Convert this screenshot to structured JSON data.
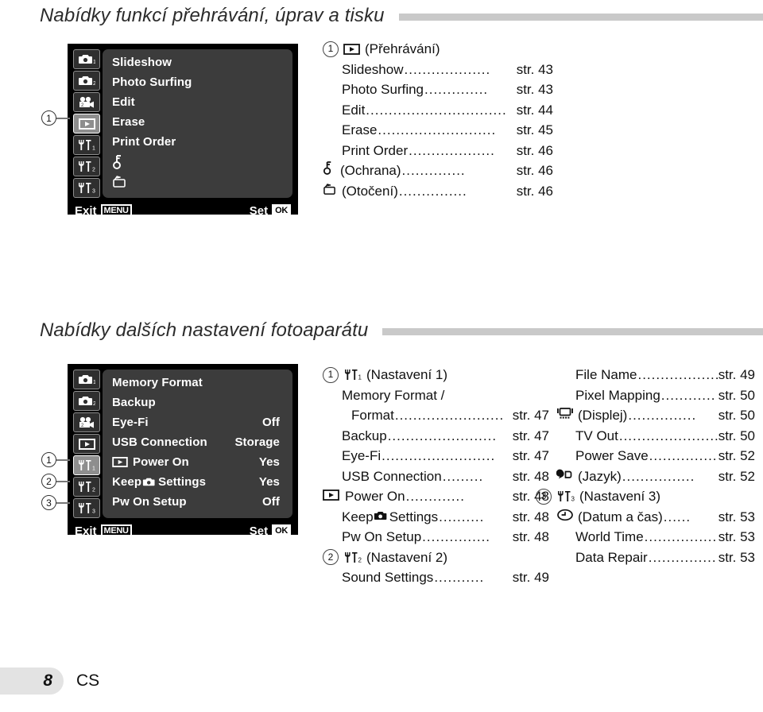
{
  "sections": [
    {
      "heading": "Nabídky funkcí přehrávání, úprav a tisku",
      "panel": {
        "tabs": [
          {
            "name": "camera1",
            "label": "■₁"
          },
          {
            "name": "camera2",
            "label": "■₂"
          },
          {
            "name": "movie",
            "label": "movie"
          },
          {
            "name": "playback",
            "label": "playback",
            "active": true
          },
          {
            "name": "wrench1",
            "label": "wrench1"
          },
          {
            "name": "wrench2",
            "label": "wrench2"
          },
          {
            "name": "wrench3",
            "label": "wrench3"
          }
        ],
        "rows": [
          {
            "label": "Slideshow",
            "value": ""
          },
          {
            "label": "Photo Surfing",
            "value": ""
          },
          {
            "label": "Edit",
            "value": ""
          },
          {
            "label": "Erase",
            "value": ""
          },
          {
            "label": "Print Order",
            "value": ""
          },
          {
            "label": "",
            "icon": "key-icon",
            "value": ""
          },
          {
            "label": "",
            "icon": "rotate-icon",
            "value": ""
          }
        ],
        "exit_label": "Exit",
        "exit_key": "MENU",
        "set_label": "Set",
        "set_key": "OK"
      },
      "callouts": [
        {
          "num": "1"
        }
      ],
      "toc": [
        {
          "num": "1",
          "icon": "playback-icon",
          "name": "(Přehrávání)",
          "dots": "",
          "page": ""
        },
        {
          "indent": 1,
          "name": "Slideshow",
          "dots": "...................",
          "page": "str. 43"
        },
        {
          "indent": 1,
          "name": "Photo Surfing",
          "dots": "..............",
          "page": "str. 43"
        },
        {
          "indent": 1,
          "name": "Edit",
          "dots": "...............................",
          "page": "str. 44"
        },
        {
          "indent": 1,
          "name": "Erase",
          "dots": "..........................",
          "page": "str. 45"
        },
        {
          "indent": 1,
          "name": "Print Order",
          "dots": "...................",
          "page": "str. 46"
        },
        {
          "indent": 1,
          "icon": "key-icon",
          "name": "(Ochrana)",
          "dots": "..............",
          "page": "str. 46"
        },
        {
          "indent": 1,
          "icon": "rotate-icon",
          "name": "(Otočení)",
          "dots": "...............",
          "page": "str. 46"
        }
      ]
    },
    {
      "heading": "Nabídky dalších nastavení fotoaparátu",
      "panel": {
        "tabs": [
          {
            "name": "camera1",
            "label": "camera1"
          },
          {
            "name": "camera2",
            "label": "camera2"
          },
          {
            "name": "movie",
            "label": "movie"
          },
          {
            "name": "playback",
            "label": "playback"
          },
          {
            "name": "wrench1",
            "label": "wrench1",
            "active": true
          },
          {
            "name": "wrench2",
            "label": "wrench2"
          },
          {
            "name": "wrench3",
            "label": "wrench3"
          }
        ],
        "rows": [
          {
            "label": "Memory Format",
            "value": ""
          },
          {
            "label": "Backup",
            "value": ""
          },
          {
            "label": "Eye-Fi",
            "value": "Off"
          },
          {
            "label": "USB Connection",
            "value": "Storage"
          },
          {
            "label": "Power On",
            "icon": "playback-icon",
            "value": "Yes"
          },
          {
            "label": "Settings",
            "pre": "Keep",
            "icon": "camera-icon",
            "value": "Yes"
          },
          {
            "label": "Pw On Setup",
            "value": "Off"
          }
        ],
        "exit_label": "Exit",
        "exit_key": "MENU",
        "set_label": "Set",
        "set_key": "OK"
      },
      "callouts": [
        {
          "num": "1"
        },
        {
          "num": "2"
        },
        {
          "num": "3"
        }
      ],
      "toc_mid": [
        {
          "num": "1",
          "icon": "wrench1-icon",
          "name": "(Nastavení 1)",
          "dots": "",
          "page": ""
        },
        {
          "indent": 1,
          "name": "Memory Format /",
          "dots": "",
          "page": ""
        },
        {
          "indent": 2,
          "name": "Format",
          "dots": "........................",
          "page": "str. 47"
        },
        {
          "indent": 1,
          "name": "Backup",
          "dots": "........................",
          "page": "str. 47"
        },
        {
          "indent": 1,
          "name": "Eye-Fi",
          "dots": ".........................",
          "page": "str. 47"
        },
        {
          "indent": 1,
          "name": "USB Connection",
          "dots": ".........",
          "page": "str. 48"
        },
        {
          "indent": 1,
          "icon": "playback-icon",
          "name": "Power On",
          "dots": ".............",
          "page": "str. 48"
        },
        {
          "indent": 1,
          "pre": "Keep",
          "icon": "camera-icon",
          "name": "Settings",
          "dots": "..........",
          "page": "str. 48"
        },
        {
          "indent": 1,
          "name": "Pw On Setup",
          "dots": "...............",
          "page": "str. 48"
        },
        {
          "num": "2",
          "icon": "wrench2-icon",
          "name": "(Nastavení 2)",
          "dots": "",
          "page": ""
        },
        {
          "indent": 1,
          "name": "Sound Settings",
          "dots": "...........",
          "page": "str. 49"
        }
      ],
      "toc_right": [
        {
          "indent": 1,
          "name": "File Name",
          "dots": "...................",
          "page": "str. 49"
        },
        {
          "indent": 1,
          "name": "Pixel Mapping",
          "dots": "............",
          "page": "str. 50"
        },
        {
          "indent": 1,
          "icon": "display-icon",
          "name": "(Displej)",
          "dots": "...............",
          "page": "str. 50"
        },
        {
          "indent": 1,
          "name": "TV Out",
          "dots": "........................",
          "page": "str. 50"
        },
        {
          "indent": 1,
          "name": "Power Save",
          "dots": "................",
          "page": "str. 52"
        },
        {
          "indent": 1,
          "icon": "language-icon",
          "name": "(Jazyk)",
          "dots": "................",
          "page": "str. 52"
        },
        {
          "num": "3",
          "icon": "wrench3-icon",
          "name": "(Nastavení 3)",
          "dots": "",
          "page": ""
        },
        {
          "indent": 1,
          "icon": "clock-icon",
          "name": "(Datum a čas)",
          "dots": "......",
          "page": "str. 53"
        },
        {
          "indent": 1,
          "name": "World Time",
          "dots": ".................",
          "page": "str. 53"
        },
        {
          "indent": 1,
          "name": "Data Repair",
          "dots": "................",
          "page": "str. 53"
        }
      ]
    }
  ],
  "footer": {
    "page_number": "8",
    "language_code": "CS"
  },
  "colors": {
    "rule": "#c9c9c9",
    "lcd_bg": "#000000",
    "lcd_pane": "#3c3c3c",
    "tab_bg": "#2f2f2f",
    "tab_active": "#8e8e8e",
    "page_box": "#e3e3e3"
  }
}
